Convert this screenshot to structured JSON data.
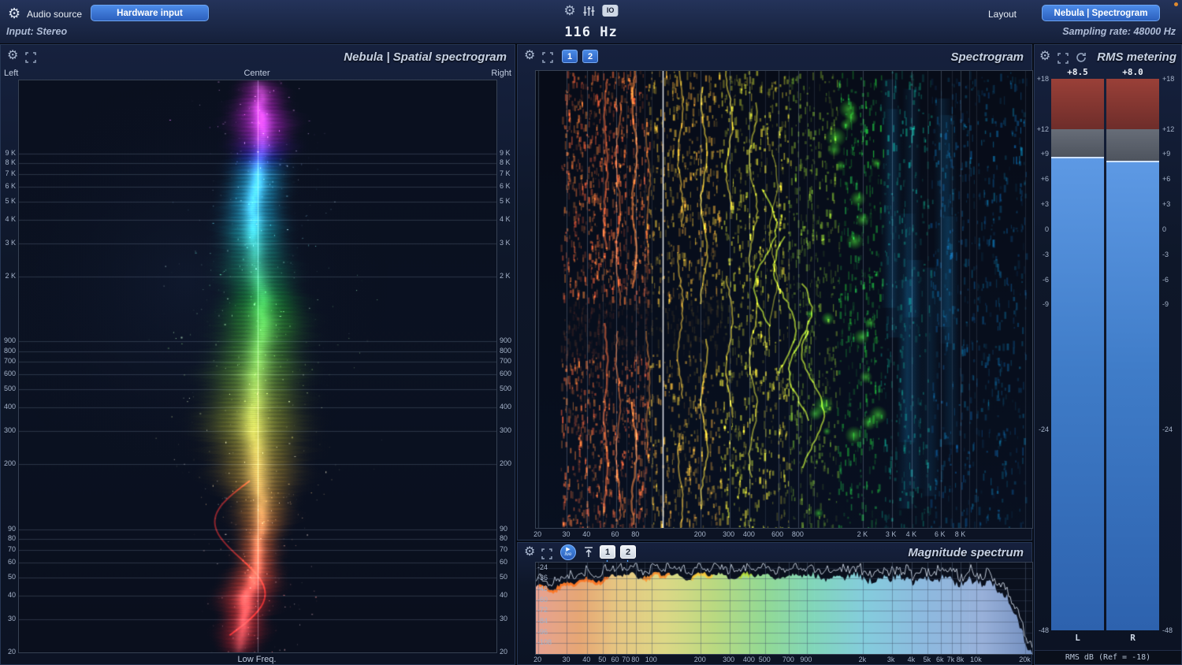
{
  "top_bar": {
    "audio_source_label": "Audio source",
    "hardware_input_button": "Hardware input",
    "input_status": "Input: Stereo",
    "io_button": "IO",
    "frequency_readout": "116 Hz",
    "frequency_hz": 116,
    "layout_button": "Layout",
    "view_button": "Nebula | Spectrogram",
    "sampling_rate_status": "Sampling rate: 48000 Hz"
  },
  "spatial_panel": {
    "title": "Nebula | Spatial spectrogram",
    "pan_left": "Left",
    "pan_center": "Center",
    "pan_right": "Right",
    "bottom_label": "Low Freq.",
    "freq_ticks": [
      {
        "label": "9 K",
        "f": 9000
      },
      {
        "label": "8 K",
        "f": 8000
      },
      {
        "label": "7 K",
        "f": 7000
      },
      {
        "label": "6 K",
        "f": 6000
      },
      {
        "label": "5 K",
        "f": 5000
      },
      {
        "label": "4 K",
        "f": 4000
      },
      {
        "label": "3 K",
        "f": 3000
      },
      {
        "label": "2 K",
        "f": 2000
      },
      {
        "label": "900",
        "f": 900
      },
      {
        "label": "800",
        "f": 800
      },
      {
        "label": "700",
        "f": 700
      },
      {
        "label": "600",
        "f": 600
      },
      {
        "label": "500",
        "f": 500
      },
      {
        "label": "400",
        "f": 400
      },
      {
        "label": "300",
        "f": 300
      },
      {
        "label": "200",
        "f": 200
      },
      {
        "label": "90",
        "f": 90
      },
      {
        "label": "80",
        "f": 80
      },
      {
        "label": "70",
        "f": 70
      },
      {
        "label": "60",
        "f": 60
      },
      {
        "label": "50",
        "f": 50
      },
      {
        "label": "40",
        "f": 40
      },
      {
        "label": "30",
        "f": 30
      },
      {
        "label": "20",
        "f": 20
      }
    ]
  },
  "spectrogram_panel": {
    "title": "Spectrogram",
    "layer_buttons": [
      "1",
      "2"
    ],
    "freq_ticks": [
      {
        "label": "20",
        "f": 20
      },
      {
        "label": "30",
        "f": 30
      },
      {
        "label": "40",
        "f": 40
      },
      {
        "label": "60",
        "f": 60
      },
      {
        "label": "80",
        "f": 80
      },
      {
        "label": "200",
        "f": 200
      },
      {
        "label": "300",
        "f": 300
      },
      {
        "label": "400",
        "f": 400
      },
      {
        "label": "600",
        "f": 600
      },
      {
        "label": "800",
        "f": 800
      },
      {
        "label": "2 K",
        "f": 2000
      },
      {
        "label": "3 K",
        "f": 3000
      },
      {
        "label": "4 K",
        "f": 4000
      },
      {
        "label": "6 K",
        "f": 6000
      },
      {
        "label": "8 K",
        "f": 8000
      }
    ]
  },
  "magnitude_panel": {
    "title": "Magnitude spectrum",
    "live_button": "live",
    "layer_buttons": [
      "1",
      "2"
    ],
    "db_ticks": [
      {
        "label": "-24",
        "db": -24
      },
      {
        "label": "-36",
        "db": -36
      },
      {
        "label": "-48",
        "db": -48
      },
      {
        "label": "-60",
        "db": -60
      },
      {
        "label": "-72",
        "db": -72
      },
      {
        "label": "-84",
        "db": -84
      },
      {
        "label": "-96",
        "db": -96
      },
      {
        "label": "-108",
        "db": -108
      }
    ],
    "freq_ticks": [
      {
        "label": "20",
        "f": 20
      },
      {
        "label": "30",
        "f": 30
      },
      {
        "label": "40",
        "f": 40
      },
      {
        "label": "50",
        "f": 50
      },
      {
        "label": "60",
        "f": 60
      },
      {
        "label": "70",
        "f": 70
      },
      {
        "label": "80",
        "f": 80
      },
      {
        "label": "100",
        "f": 100
      },
      {
        "label": "200",
        "f": 200
      },
      {
        "label": "300",
        "f": 300
      },
      {
        "label": "400",
        "f": 400
      },
      {
        "label": "500",
        "f": 500
      },
      {
        "label": "700",
        "f": 700
      },
      {
        "label": "900",
        "f": 900
      },
      {
        "label": "2k",
        "f": 2000
      },
      {
        "label": "3k",
        "f": 3000
      },
      {
        "label": "4k",
        "f": 4000
      },
      {
        "label": "5k",
        "f": 5000
      },
      {
        "label": "6k",
        "f": 6000
      },
      {
        "label": "7k",
        "f": 7000
      },
      {
        "label": "8k",
        "f": 8000
      },
      {
        "label": "10k",
        "f": 10000
      },
      {
        "label": "20k",
        "f": 20000
      }
    ]
  },
  "rms_panel": {
    "title": "RMS metering",
    "left_readout": "+8.5",
    "right_readout": "+8.0",
    "left_db": 8.5,
    "right_db": 8.0,
    "scale_top_db": 18,
    "scale_bottom_db": -48,
    "red_zone_bottom_db": 12,
    "scale_ticks": [
      {
        "label": "+18",
        "db": 18
      },
      {
        "label": "+12",
        "db": 12
      },
      {
        "label": "+9",
        "db": 9
      },
      {
        "label": "+6",
        "db": 6
      },
      {
        "label": "+3",
        "db": 3
      },
      {
        "label": "0",
        "db": 0
      },
      {
        "label": "-3",
        "db": -3
      },
      {
        "label": "-6",
        "db": -6
      },
      {
        "label": "-9",
        "db": -9
      },
      {
        "label": "-24",
        "db": -24
      },
      {
        "label": "-48",
        "db": -48
      }
    ],
    "left_channel": "L",
    "right_channel": "R",
    "footer": "RMS dB (Ref = -18)"
  },
  "colors": {
    "accent_blue": "#3a7bd5",
    "meter_fill_blue": "#3f7cc8",
    "meter_red_zone": "#7e3430",
    "background": "#0b1222"
  }
}
